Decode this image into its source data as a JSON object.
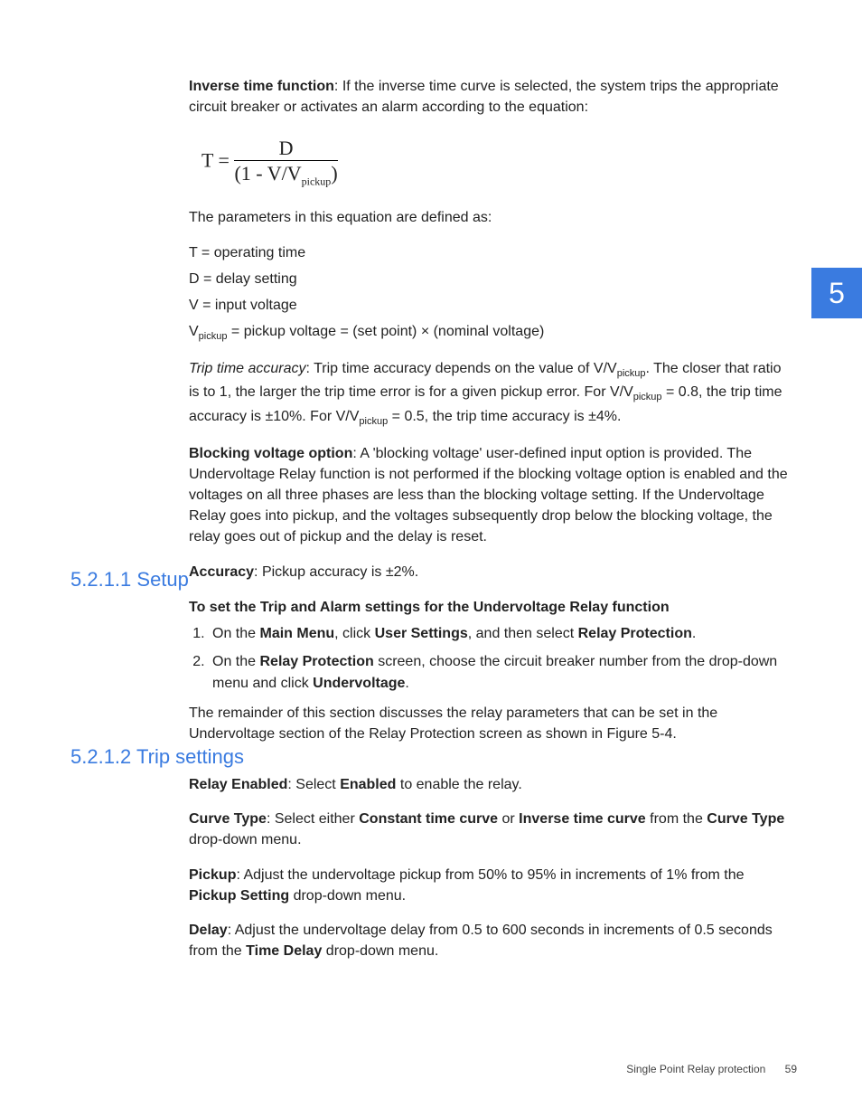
{
  "chapterTab": "5",
  "intro": {
    "p1_a": "Inverse time function",
    "p1_b": ": If the inverse time curve is selected, the system trips the appropriate circuit breaker or activates an alarm according to the equation:",
    "eq_T": "T",
    "eq_eq": " = ",
    "eq_num": "D",
    "eq_den_a": "(1 - V",
    "eq_den_slash": "/",
    "eq_den_b": "V",
    "eq_den_sub": "pickup",
    "eq_den_c": ")",
    "p2": "The parameters in this equation are defined as:",
    "def_T": "T = operating time",
    "def_D": "D = delay setting",
    "def_V": "V = input voltage",
    "def_Vp_a": "V",
    "def_Vp_sub": "pickup",
    "def_Vp_b": " = pickup voltage = (set point) × (nominal voltage)",
    "p3_a": "Trip time accuracy",
    "p3_b": ": Trip time accuracy depends on the value of V/V",
    "p3_sub1": "pickup",
    "p3_c": ". The closer that ratio is to 1, the larger the trip time error is for a given pickup error. For V/V",
    "p3_sub2": "pickup",
    "p3_d": " = 0.8, the trip time accuracy is ±10%. For V/V",
    "p3_sub3": "pickup",
    "p3_e": " = 0.5, the trip time accuracy is ±4%.",
    "p4_a": "Blocking voltage option",
    "p4_b": ": A 'blocking voltage' user-defined input option is provided. The Undervoltage Relay function is not performed if the blocking voltage option is enabled and the voltages on all three phases are less than the blocking voltage setting. If the Undervoltage Relay goes into pickup, and the voltages subsequently drop below the blocking voltage, the relay goes out of pickup and the delay is reset.",
    "p5_a": "Accuracy",
    "p5_b": ": Pickup accuracy is ±2%."
  },
  "setup": {
    "heading": "5.2.1.1 Setup",
    "lead": "To set the Trip and Alarm settings for the Undervoltage Relay function",
    "step1_a": "On the ",
    "step1_b": "Main Menu",
    "step1_c": ", click ",
    "step1_d": "User Settings",
    "step1_e": ", and then select ",
    "step1_f": "Relay Protection",
    "step1_g": ".",
    "step2_a": "On the ",
    "step2_b": "Relay Protection",
    "step2_c": " screen, choose the circuit breaker number from the drop-down menu and click ",
    "step2_d": "Undervoltage",
    "step2_e": ".",
    "tail": "The remainder of this section discusses the relay parameters that can be set in the Undervoltage section of the Relay Protection screen as shown in Figure 5-4."
  },
  "trip": {
    "heading": "5.2.1.2 Trip settings",
    "p1_a": "Relay Enabled",
    "p1_b": ": Select ",
    "p1_c": "Enabled",
    "p1_d": " to enable the relay.",
    "p2_a": "Curve Type",
    "p2_b": ": Select either ",
    "p2_c": "Constant time curve",
    "p2_d": " or ",
    "p2_e": "Inverse time curve",
    "p2_f": " from the ",
    "p2_g": "Curve Type",
    "p2_h": " drop-down menu.",
    "p3_a": "Pickup",
    "p3_b": ": Adjust the undervoltage pickup from 50% to 95% in increments of 1% from the ",
    "p3_c": "Pickup Setting",
    "p3_d": " drop-down menu.",
    "p4_a": "Delay",
    "p4_b": ": Adjust the undervoltage delay from 0.5 to 600 seconds in increments of 0.5 seconds from the ",
    "p4_c": "Time Delay",
    "p4_d": " drop-down menu."
  },
  "footer": {
    "title": "Single Point Relay protection",
    "page": "59"
  }
}
